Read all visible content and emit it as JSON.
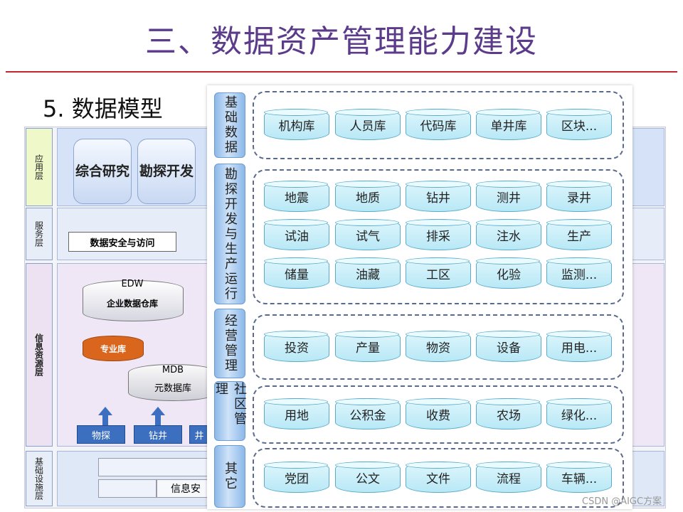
{
  "title": "三、数据资产管理能力建设",
  "subtitle": "5. 数据模型",
  "background": {
    "layers": [
      "应用层",
      "服务层",
      "信息资源层",
      "基础设施层"
    ],
    "apps": [
      "综合研究",
      "勘探开发"
    ],
    "service": "数据安全与访问",
    "edw": {
      "line1": "EDW",
      "line2": "企业数据仓库"
    },
    "specialty_db": "专业库",
    "mdb": {
      "line1": "MDB",
      "line2": "元数据库"
    },
    "sources": [
      "物探",
      "钻井",
      "井"
    ],
    "base_text": "信息安"
  },
  "categories": [
    {
      "label": "基础数据",
      "items": [
        "机构库",
        "人员库",
        "代码库",
        "单井库",
        "区块..."
      ]
    },
    {
      "label": "勘探开发与生产运行",
      "items": [
        "地震",
        "地质",
        "钻井",
        "测井",
        "录井",
        "试油",
        "试气",
        "排采",
        "注水",
        "生产",
        "储量",
        "油藏",
        "工区",
        "化验",
        "监测..."
      ]
    },
    {
      "label": "经营管理",
      "items": [
        "投资",
        "产量",
        "物资",
        "设备",
        "用电..."
      ]
    },
    {
      "label": "社区管理",
      "items": [
        "用地",
        "公积金",
        "收费",
        "农场",
        "绿化..."
      ]
    },
    {
      "label": "其它",
      "items": [
        "党团",
        "公文",
        "文件",
        "流程",
        "车辆..."
      ]
    }
  ],
  "watermark": "CSDN @AIGC方案",
  "colors": {
    "title": "#5b3b8a",
    "rule": "#c0282d",
    "category": "#8cb8e8",
    "pill": "#b8e8f6",
    "orange": "#d9661c"
  }
}
